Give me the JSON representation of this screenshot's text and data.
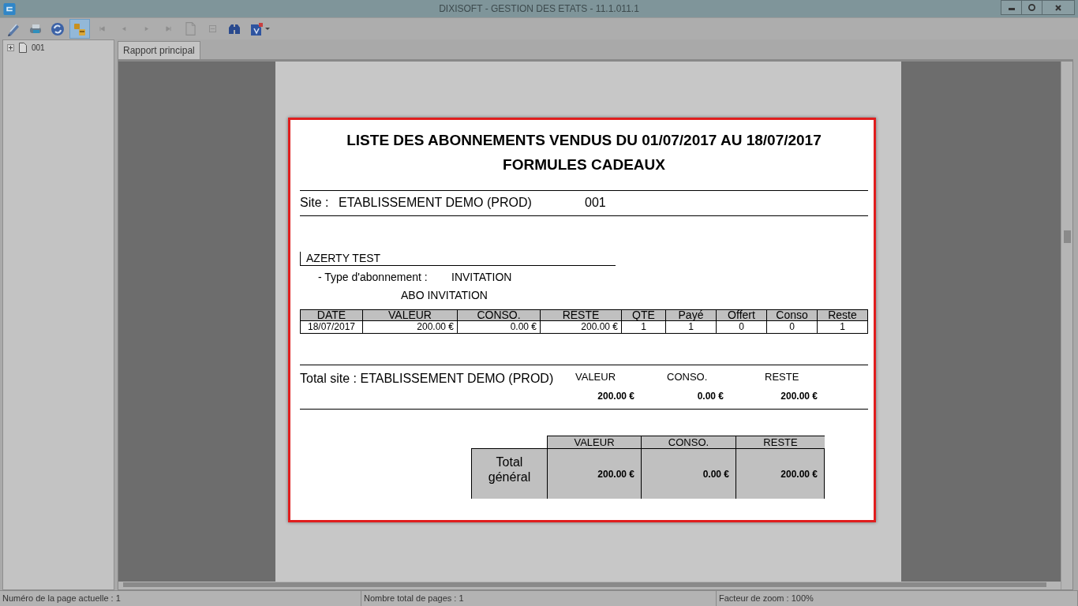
{
  "window": {
    "title": "DIXISOFT - GESTION DES ETATS - 11.1.011.1"
  },
  "toolbar": [
    {
      "selected": false,
      "disabled": false,
      "dropdown": false
    },
    {
      "selected": false,
      "disabled": false,
      "dropdown": false
    },
    {
      "selected": false,
      "disabled": false,
      "dropdown": false
    },
    {
      "selected": true,
      "disabled": false,
      "dropdown": false
    },
    {
      "selected": false,
      "disabled": true,
      "dropdown": false
    },
    {
      "selected": false,
      "disabled": true,
      "dropdown": false
    },
    {
      "selected": false,
      "disabled": true,
      "dropdown": false
    },
    {
      "selected": false,
      "disabled": true,
      "dropdown": false
    },
    {
      "selected": false,
      "disabled": true,
      "dropdown": false
    },
    {
      "selected": false,
      "disabled": true,
      "dropdown": false
    },
    {
      "selected": false,
      "disabled": false,
      "dropdown": false
    },
    {
      "selected": false,
      "disabled": false,
      "dropdown": true
    }
  ],
  "tree": {
    "items": [
      {
        "label": "001",
        "expanded": false
      }
    ]
  },
  "tabs": [
    {
      "label": "Rapport principal",
      "selected": true
    }
  ],
  "report": {
    "title_lines": [
      "LISTE DES ABONNEMENTS VENDUS DU 01/07/2017 AU 18/07/2017",
      "FORMULES CADEAUX"
    ],
    "site": {
      "label": "Site :",
      "name": "ETABLISSEMENT DEMO (PROD)",
      "code": "001"
    },
    "client": {
      "name": "AZERTY TEST",
      "type_label": "- Type d'abonnement :",
      "type_value": "INVITATION",
      "formula": "ABO INVITATION"
    },
    "table": {
      "columns": [
        "DATE",
        "VALEUR",
        "CONSO.",
        "RESTE",
        "QTE",
        "Payé",
        "Offert",
        "Conso",
        "Reste"
      ],
      "rows": [
        [
          "18/07/2017",
          "200.00 €",
          "0.00 €",
          "200.00 €",
          "1",
          "1",
          "0",
          "0",
          "1"
        ]
      ]
    },
    "site_total": {
      "label": "Total site : ETABLISSEMENT DEMO (PROD)",
      "columns": [
        "VALEUR",
        "CONSO.",
        "RESTE"
      ],
      "values": [
        "200.00 €",
        "0.00 €",
        "200.00 €"
      ]
    },
    "grand_total": {
      "label": "Total général",
      "columns": [
        "VALEUR",
        "CONSO.",
        "RESTE"
      ],
      "values": [
        "200.00 €",
        "0.00 €",
        "200.00 €"
      ]
    }
  },
  "status_bar": {
    "fields": [
      "Numéro de la page actuelle : 1",
      "Nombre total de pages : 1",
      "Facteur de zoom : 100%"
    ]
  }
}
